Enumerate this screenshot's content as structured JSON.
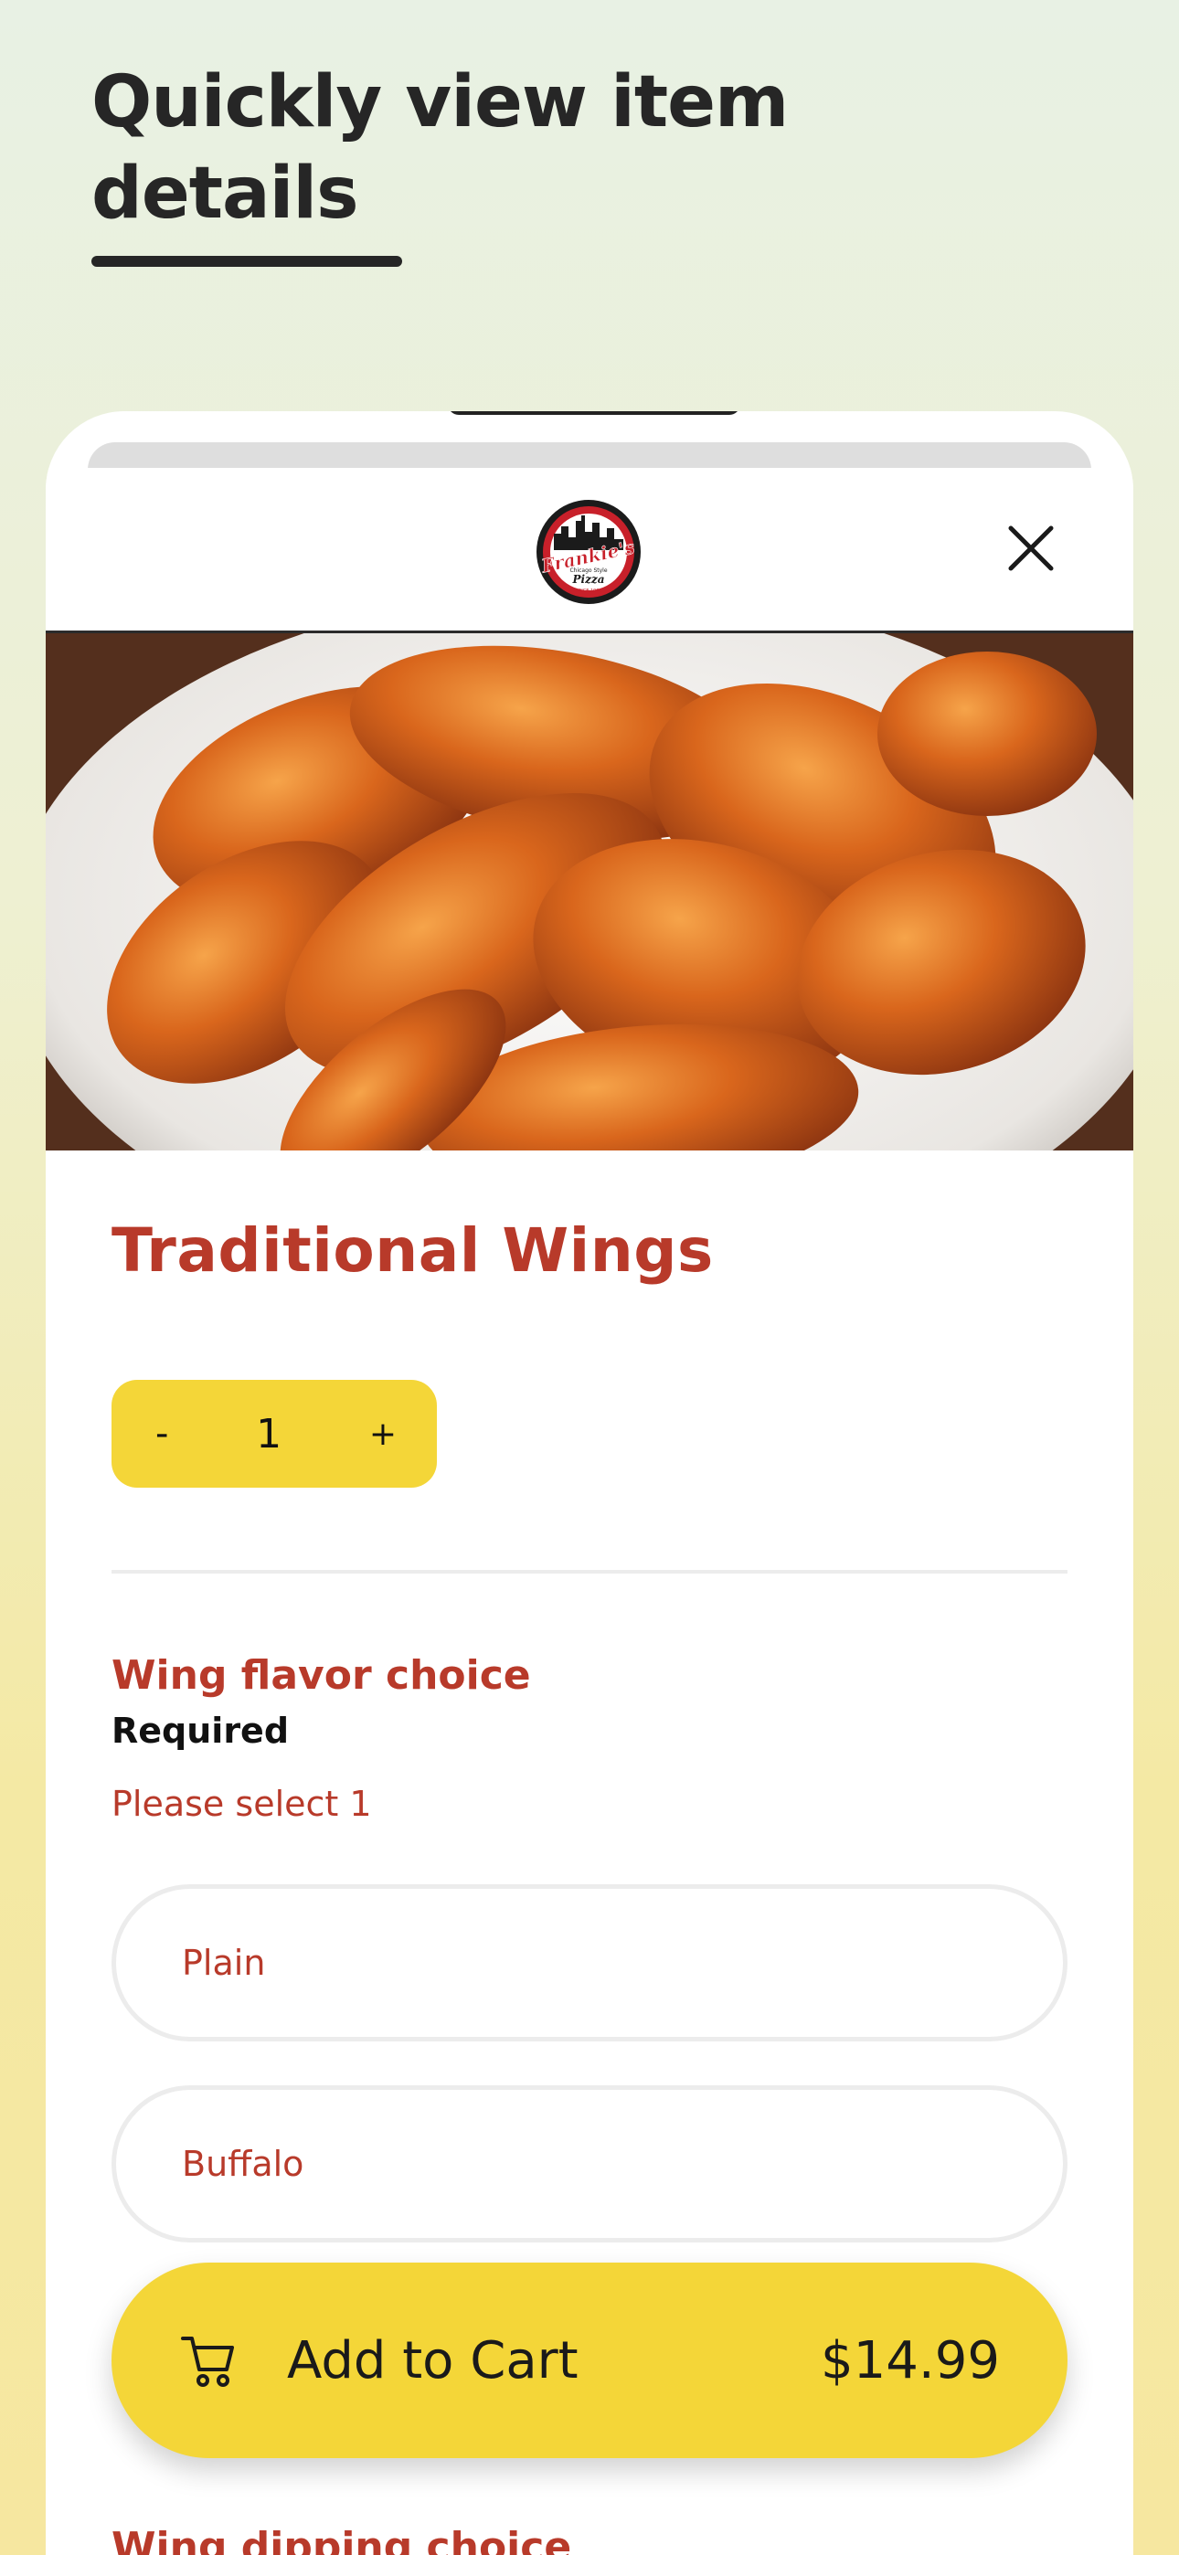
{
  "headline": "Quickly view item details",
  "modal": {
    "logo_text": {
      "line1": "Frankie's",
      "line2": "Chicago Style",
      "line3": "Pizza",
      "line4": "SINCE 1984"
    },
    "close_icon": "close-icon"
  },
  "item": {
    "title": "Traditional Wings",
    "photo": "buffalo-wings-photo"
  },
  "stepper": {
    "minus": "-",
    "quantity": "1",
    "plus": "+"
  },
  "option_group": {
    "title": "Wing flavor choice",
    "required_label": "Required",
    "hint": "Please select 1",
    "options": [
      "Plain",
      "Buffalo"
    ]
  },
  "cart": {
    "icon": "cart-icon",
    "label": "Add to Cart",
    "price": "$14.99"
  },
  "next_section_title": "Wing dipping choice",
  "colors": {
    "accent_red": "#b83a2a",
    "accent_yellow": "#f4d638"
  }
}
